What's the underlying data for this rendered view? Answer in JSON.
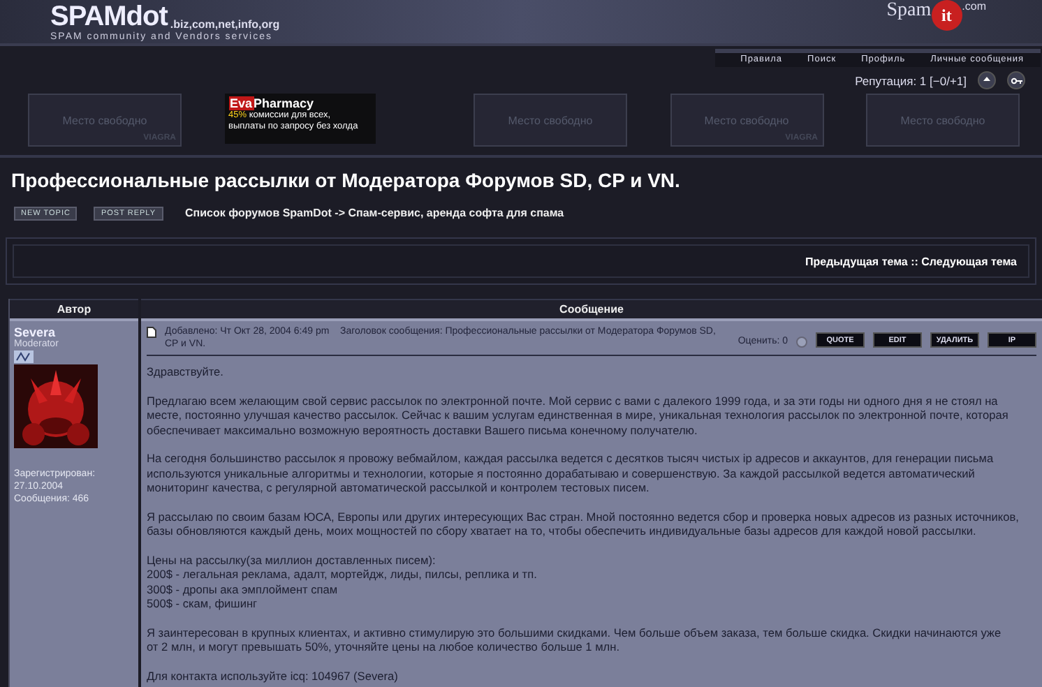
{
  "logo": {
    "name": "SPAMdot",
    "domains": ".biz,com,net,info,org",
    "tagline": "SPAM community and Vendors services"
  },
  "partner_logo": {
    "left": "Spam",
    "badge": "it",
    "right": ".com"
  },
  "top_nav": [
    "Правила",
    "Поиск",
    "Профиль",
    "Личные сообщения"
  ],
  "reputation": "Репутация: 1 [−0/+1]",
  "ads": [
    {
      "kind": "free",
      "text": "Место свободно",
      "tag": "VIAGRA"
    },
    {
      "kind": "banner",
      "brand_a": "Eva",
      "brand_b": "Pharmacy",
      "line1_accent": "45%",
      "line1": " комиссии для всех,",
      "line2": "выплаты по запросу без холда"
    },
    {
      "kind": "free",
      "text": "Место свободно"
    },
    {
      "kind": "free",
      "text": "Место свободно",
      "tag": "VIAGRA"
    },
    {
      "kind": "free",
      "text": "Место свободно"
    }
  ],
  "topic_title": "Профессиональные рассылки от Модератора Форумов SD, CP и VN.",
  "action_buttons": [
    "NEW TOPIC",
    "POST REPLY"
  ],
  "breadcrumb": "Список форумов SpamDot -> Спам-сервис, аренда софта для спама",
  "topic_nav": "Предыдущая тема :: Следующая тема",
  "columns": [
    "Автор",
    "Сообщение"
  ],
  "post": {
    "author": "Severa",
    "rank": "Moderator",
    "registered_label": "Зарегистрирован:",
    "registered": "27.10.2004",
    "posts": "Сообщения: 466",
    "added": "Добавлено: Чт Окт 28, 2004 6:49 pm",
    "subject": "Заголовок сообщения: Профессиональные рассылки от Модератора Форумов SD, CP и VN.",
    "rate": "Оценить: 0",
    "buttons": [
      "QUOTE",
      "EDIT",
      "УДАЛИТЬ",
      "IP"
    ],
    "paragraphs": [
      [
        "Здравствуйте."
      ],
      [
        "Предлагаю всем желающим свой сервис рассылок по электронной почте. Мой сервис с вами с далекого 1999 года, и за эти годы ни одного дня я не стоял на",
        "месте, постоянно улучшая качество рассылок. Сейчас к вашим услугам единственная в мире, уникальная технология рассылок по электронной почте, которая",
        "обеспечивает максимально возможную вероятность доставки Вашего письма конечному получателю."
      ],
      [
        "На сегодня большинство рассылок я провожу вебмайлом, каждая рассылка ведется с десятков тысяч чистых ip адресов и аккаунтов, для генерации письма",
        "используются уникальные алгоритмы и технологии, которые я постоянно дорабатываю и совершенствую. За каждой рассылкой ведется автоматический",
        "мониторинг качества, с регулярной автоматической рассылкой и контролем тестовых писем."
      ],
      [
        "Я рассылаю по своим базам ЮСА, Европы или других интересующих Вас стран. Мной постоянно ведется сбор и проверка новых адресов из разных источников,",
        "базы обновляются каждый день, моих мощностей по сбору хватает на то, чтобы обеспечить индивидуальные базы адресов для каждой новой рассылки."
      ],
      [
        "Цены на рассылку(за миллион доставленных писем):",
        "200$ - легальная реклама, адалт, мортейдж, лиды, пилсы, реплика и тп.",
        "300$ - дропы ака эмплоймент спам",
        "500$ - скам, фишинг"
      ],
      [
        "Я заинтересован в крупных клиентах, и активно стимулирую это большими скидками. Чем больше объем заказа, тем больше скидка. Скидки начинаются уже",
        "от 2 млн, и могут превышать 50%, уточняйте цены на любое количество больше 1 млн."
      ],
      [
        "Для контакта используйте icq: 104967 (Severa)"
      ]
    ]
  }
}
